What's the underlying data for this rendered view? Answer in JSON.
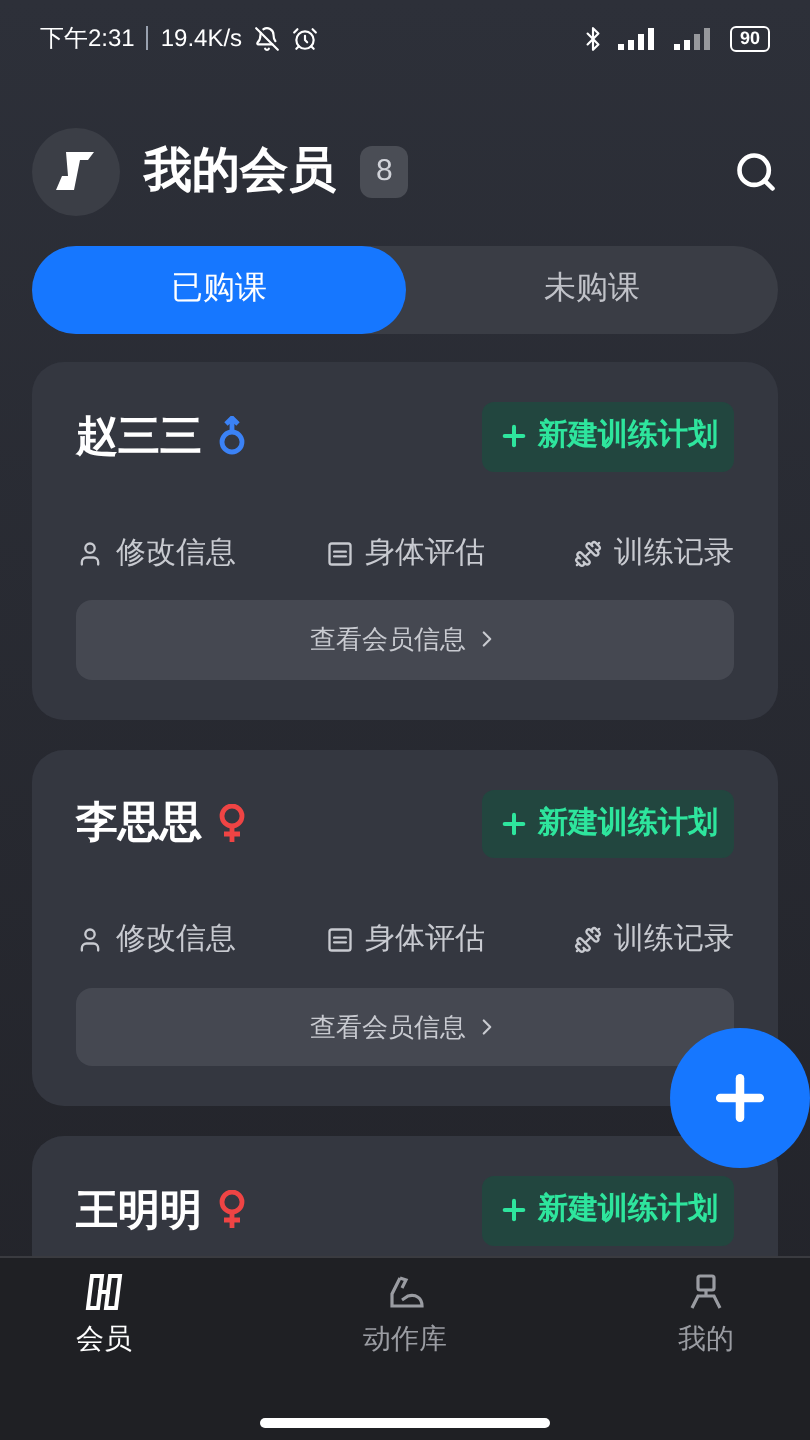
{
  "status_bar": {
    "time": "下午2:31",
    "speed": "19.4K/s",
    "battery": "90"
  },
  "header": {
    "title": "我的会员",
    "count": "8"
  },
  "tabs": [
    {
      "label": "已购课",
      "selected": true
    },
    {
      "label": "未购课",
      "selected": false
    }
  ],
  "members": [
    {
      "name": "赵三三",
      "male": true,
      "plan_button": "新建训练计划",
      "actions": [
        "修改信息",
        "身体评估",
        "训练记录"
      ],
      "details_button": "查看会员信息"
    },
    {
      "name": "李思思",
      "male": false,
      "plan_button": "新建训练计划",
      "actions": [
        "修改信息",
        "身体评估",
        "训练记录"
      ],
      "details_button": "查看会员信息"
    },
    {
      "name": "王明明",
      "male": false,
      "plan_button": "新建训练计划"
    }
  ],
  "bottom_nav": [
    {
      "label": "会员",
      "selected": true
    },
    {
      "label": "动作库",
      "selected": false
    },
    {
      "label": "我的",
      "selected": false
    }
  ]
}
